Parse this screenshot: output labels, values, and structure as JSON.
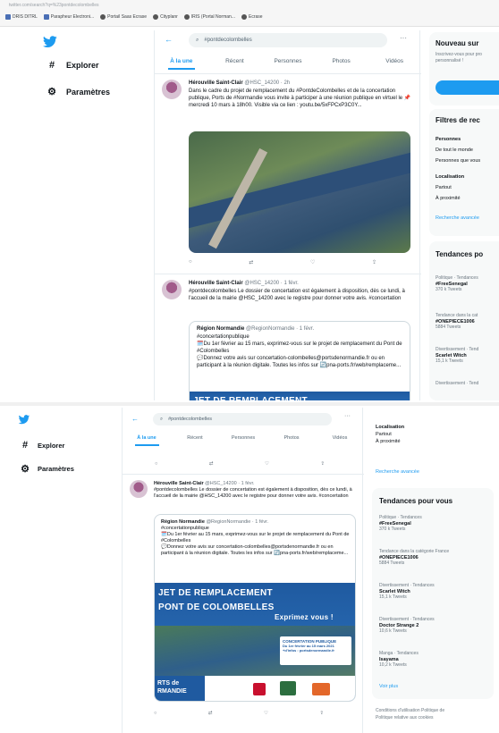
{
  "chrome": {
    "url": "twitter.com/search?q=%23pontdecolombelles",
    "bookmarks": [
      {
        "label": "DRIS DITRL",
        "icon": "bookmark-icon",
        "color": "#4a6fb5"
      },
      {
        "label": "Parapheur Electroni...",
        "icon": "bookmark-icon",
        "color": "#4a6fb5"
      },
      {
        "label": "Portail Saas Ecrase",
        "icon": "globe-icon",
        "color": "#555555"
      },
      {
        "label": "Cityplanr",
        "icon": "globe-icon",
        "color": "#555555"
      },
      {
        "label": "IRIS (Portal Norman...",
        "icon": "globe-icon",
        "color": "#555555"
      },
      {
        "label": "Ecrase",
        "icon": "globe-icon",
        "color": "#555555"
      }
    ]
  },
  "nav": {
    "explore": "Explorer",
    "settings": "Paramètres"
  },
  "search": {
    "query": "#pontdecolombelles"
  },
  "tabs": [
    "À la une",
    "Récent",
    "Personnes",
    "Photos",
    "Vidéos"
  ],
  "tweet1": {
    "name": "Hérouville Saint-Clair",
    "handle": "@HSC_14200 · 2h",
    "text": "Dans le cadre du projet de remplacement du #PontdeColombelles et de la concertation publique, Ports de #Normandie vous invite à participer à une réunion publique en virtuel le 📌 mercredi 10 mars à 18h00. Visible via ce lien : youtu.be/5xFPCxP3C0Y..."
  },
  "tweet2": {
    "name": "Hérouville Saint-Clair",
    "handle": "@HSC_14200 · 1 févr.",
    "text": "#pontdecolombelles Le dossier de concertation est également à disposition, dès ce lundi, à l'accueil de la mairie @HSC_14200 avec le registre pour donner votre avis. #concertation"
  },
  "quote": {
    "name": "Région Normandie",
    "handle": "@RegionNormandie · 1 févr.",
    "line1": "#concertationpublique",
    "line2": "🗓️Du 1er février au 15 mars, exprimez-vous sur le projet de remplacement du Pont de #Colombelles",
    "line3": "💬Donnez votre avis sur concertation-colombelles@portsdenormandie.fr ou en participant à la réunion digitale. Toutes les infos sur 🔄pna-ports.fr/web/remplaceme...",
    "banner1": "JET DE REMPLACEMENT",
    "banner2": "PONT DE COLOMBELLES",
    "exprimez": "Exprimez vous !",
    "concert_title": "CONCERTATION PUBLIQUE",
    "concert_dates": "Du 1er février au 15 mars 2021",
    "concert_info": "+d'infos : portsdenormandie.fr",
    "ports": "RTS de",
    "normandie": "RMANDIE"
  },
  "sidebar": {
    "new_title": "Nouveau sur",
    "new_text1": "Inscrivez-vous pour pro",
    "new_text2": "personnalisé !",
    "filters_title": "Filtres de rec",
    "filters_title_full": "Filtres de recherche",
    "people": "Personnes",
    "everyone": "De tout le monde",
    "following": "Personnes que vous",
    "location": "Localisation",
    "anywhere": "Partout",
    "nearby": "À proximité",
    "advanced": "Recherche avancée",
    "trends_title": "Tendances po",
    "trends_title_full": "Tendances pour vous",
    "trends": [
      {
        "category": "Politique · Tendances",
        "name": "#FreeSenegal",
        "count": "370 k Tweets"
      },
      {
        "category": "Tendance dans la catégorie France",
        "name": "#ONEPIECE1006",
        "count": "5884 Tweets"
      },
      {
        "category": "Divertissement · Tendances",
        "name": "Scarlet Witch",
        "count": "15,1 k Tweets"
      },
      {
        "category": "Divertissement · Tendances",
        "name": "Doctor Strange 2",
        "count": "10,6 k Tweets"
      },
      {
        "category": "Manga · Tendances",
        "name": "Isayama",
        "count": "10,2 k Tweets"
      }
    ],
    "trend1_cat_short": "Politique · Tendances",
    "trend2_cat_short": "Tendance dans la cat",
    "trend3_cat_short": "Divertissement · Tend",
    "trend4_cat_short": "Divertissement · Tend",
    "see_more": "Voir plus",
    "footer1": "Conditions d'utilisation   Politique de",
    "footer2": "Politique relative aux cookies"
  },
  "colors": {
    "accent": "#1d9bf0",
    "banner": "#1f5aa0"
  }
}
